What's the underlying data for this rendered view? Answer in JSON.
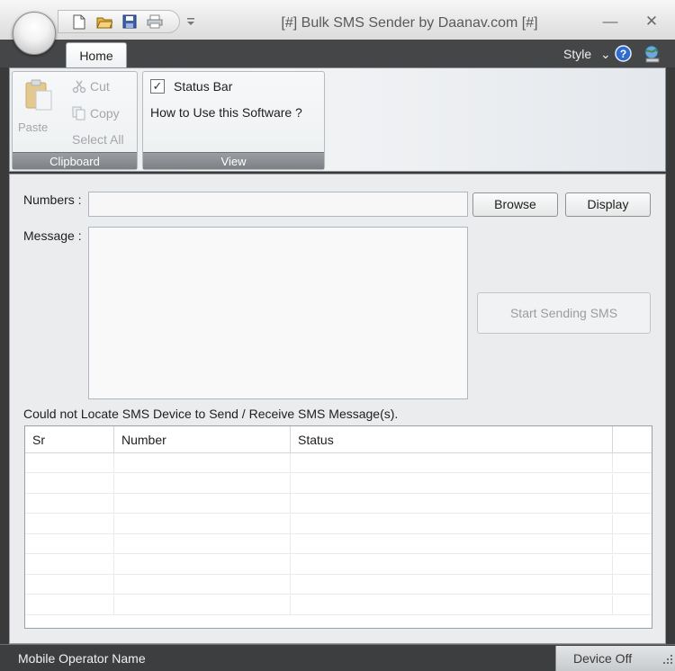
{
  "window": {
    "title": "[#] Bulk SMS Sender by Daanav.com [#]",
    "minimize_glyph": "—",
    "close_glyph": "✕"
  },
  "quick_access": {
    "icons": [
      "new-document-icon",
      "open-folder-icon",
      "save-icon",
      "print-icon",
      "customize-dropdown-icon"
    ]
  },
  "ribbon": {
    "tabs": [
      {
        "label": "Home",
        "active": true
      }
    ],
    "style_menu_label": "Style",
    "style_menu_glyph": "⌄",
    "help_glyph": "?",
    "groups": {
      "clipboard": {
        "label": "Clipboard",
        "paste_label": "Paste",
        "cut_label": "Cut",
        "copy_label": "Copy",
        "select_all_label": "Select All"
      },
      "view": {
        "label": "View",
        "status_bar_label": "Status Bar",
        "status_bar_checked": true,
        "check_glyph": "✓",
        "how_to_label": "How to Use this Software ?"
      }
    }
  },
  "form": {
    "numbers_label": "Numbers :",
    "numbers_value": "",
    "message_label": "Message :",
    "message_value": "",
    "browse_label": "Browse",
    "display_label": "Display",
    "start_sending_label": "Start Sending SMS",
    "status_message": "Could not Locate SMS Device to Send / Receive SMS Message(s)."
  },
  "grid": {
    "columns": [
      "Sr",
      "Number",
      "Status",
      ""
    ],
    "rows": []
  },
  "statusbar": {
    "operator_label": "Mobile Operator Name",
    "device_status": "Device Off"
  },
  "colors": {
    "accent_dark": "#444648",
    "ribbon_bg": "#eceff1",
    "client_bg": "#eaecee",
    "statusbar_bg": "#3c3e40"
  }
}
